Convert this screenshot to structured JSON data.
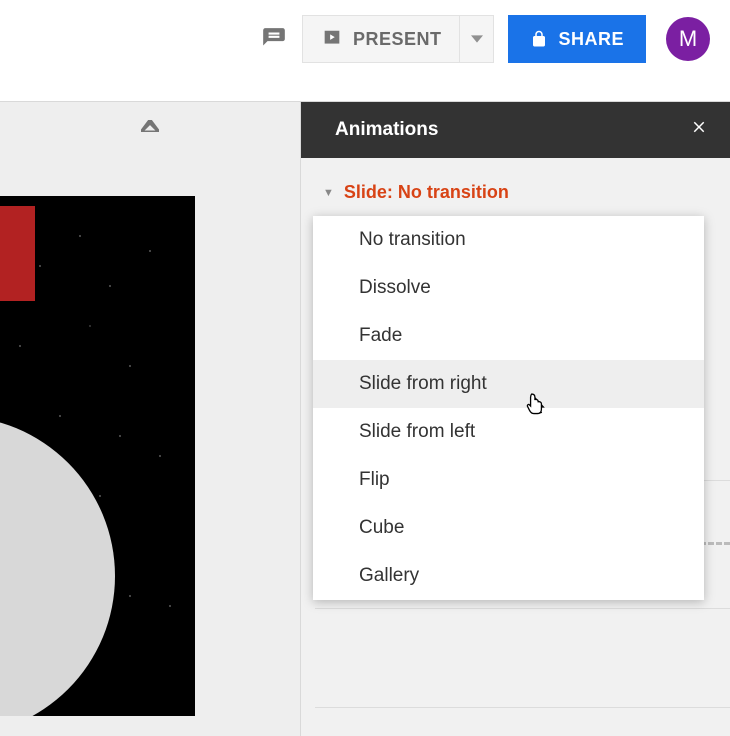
{
  "toolbar": {
    "present_label": "PRESENT",
    "share_label": "SHARE",
    "avatar_initial": "M"
  },
  "panel": {
    "title": "Animations",
    "slide_row_label": "Slide: No transition",
    "select_value": "No transition"
  },
  "dropdown": {
    "items": [
      "No transition",
      "Dissolve",
      "Fade",
      "Slide from right",
      "Slide from left",
      "Flip",
      "Cube",
      "Gallery"
    ],
    "hover_index": 3
  }
}
